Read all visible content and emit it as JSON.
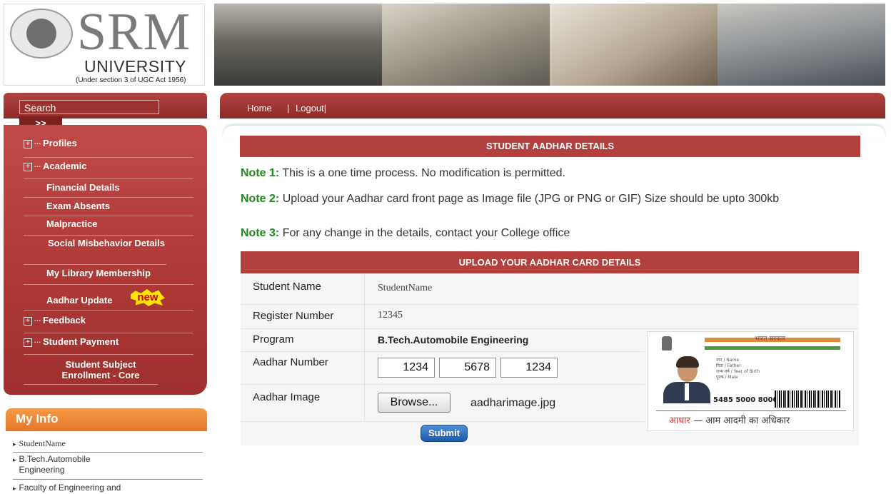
{
  "logo": {
    "name": "SRM",
    "subtitle": "UNIVERSITY",
    "note": "(Under section 3 of UGC Act 1956)"
  },
  "search": {
    "label": "Search",
    "go": ">>"
  },
  "sidebar": {
    "items": [
      {
        "label": "Profiles",
        "expand": "+",
        "dots": "···"
      },
      {
        "label": "Academic",
        "expand": "+",
        "dots": "···"
      },
      {
        "label": "Financial Details"
      },
      {
        "label": "Exam Absents"
      },
      {
        "label": "Malpractice"
      },
      {
        "label": "Social Misbehavior Details"
      },
      {
        "label": "My Library Membership"
      },
      {
        "label": "Aadhar Update",
        "badge": "new"
      },
      {
        "label": "Feedback",
        "expand": "+",
        "dots": "···"
      },
      {
        "label": "Student Payment",
        "expand": "+",
        "dots": "···"
      },
      {
        "label": "Student Subject Enrollment - Core"
      }
    ]
  },
  "myinfo": {
    "title": "My Info",
    "items": [
      "StudentName",
      "B.Tech.Automobile Engineering",
      "Faculty of Engineering and"
    ]
  },
  "nav": {
    "home": "Home",
    "separator": "|",
    "logout": "Logout|"
  },
  "page": {
    "title": "STUDENT AADHAR DETAILS"
  },
  "notes": [
    {
      "label": "Note 1:",
      "text": "This is a one time process. No modification is permitted."
    },
    {
      "label": "Note 2:",
      "text": "Upload your Aadhar card front page as Image file (JPG or PNG or GIF) Size should be upto 300kb"
    },
    {
      "label": "Note 3:",
      "text": "For any change in the details, contact your College office"
    }
  ],
  "form": {
    "title": "UPLOAD YOUR AADHAR CARD DETAILS",
    "student_name_label": "Student Name",
    "student_name": "StudentName",
    "register_label": "Register Number",
    "register_number": "12345",
    "program_label": "Program",
    "program": "B.Tech.Automobile Engineering",
    "aadhar_label": "Aadhar Number",
    "aadhar_parts": [
      "1234",
      "5678",
      "1234"
    ],
    "image_label": "Aadhar Image",
    "browse": "Browse...",
    "file_name": "aadharimage.jpg",
    "submit": "Submit"
  },
  "card": {
    "gov": "भारत सरकार",
    "lines": [
      "नाम / Name",
      "पिता / Father",
      "जन्म वर्ष / Year of Birth",
      "पुरुष / Male"
    ],
    "number": "5485 5000 8000",
    "motto_red": "आधार",
    "motto": " — आम आदमी का अधिकार"
  },
  "colors": {
    "maroon": "#b4403d",
    "orange": "#e4772a",
    "note_green": "#1e8a1e",
    "submit_blue": "#1c5aa8"
  }
}
